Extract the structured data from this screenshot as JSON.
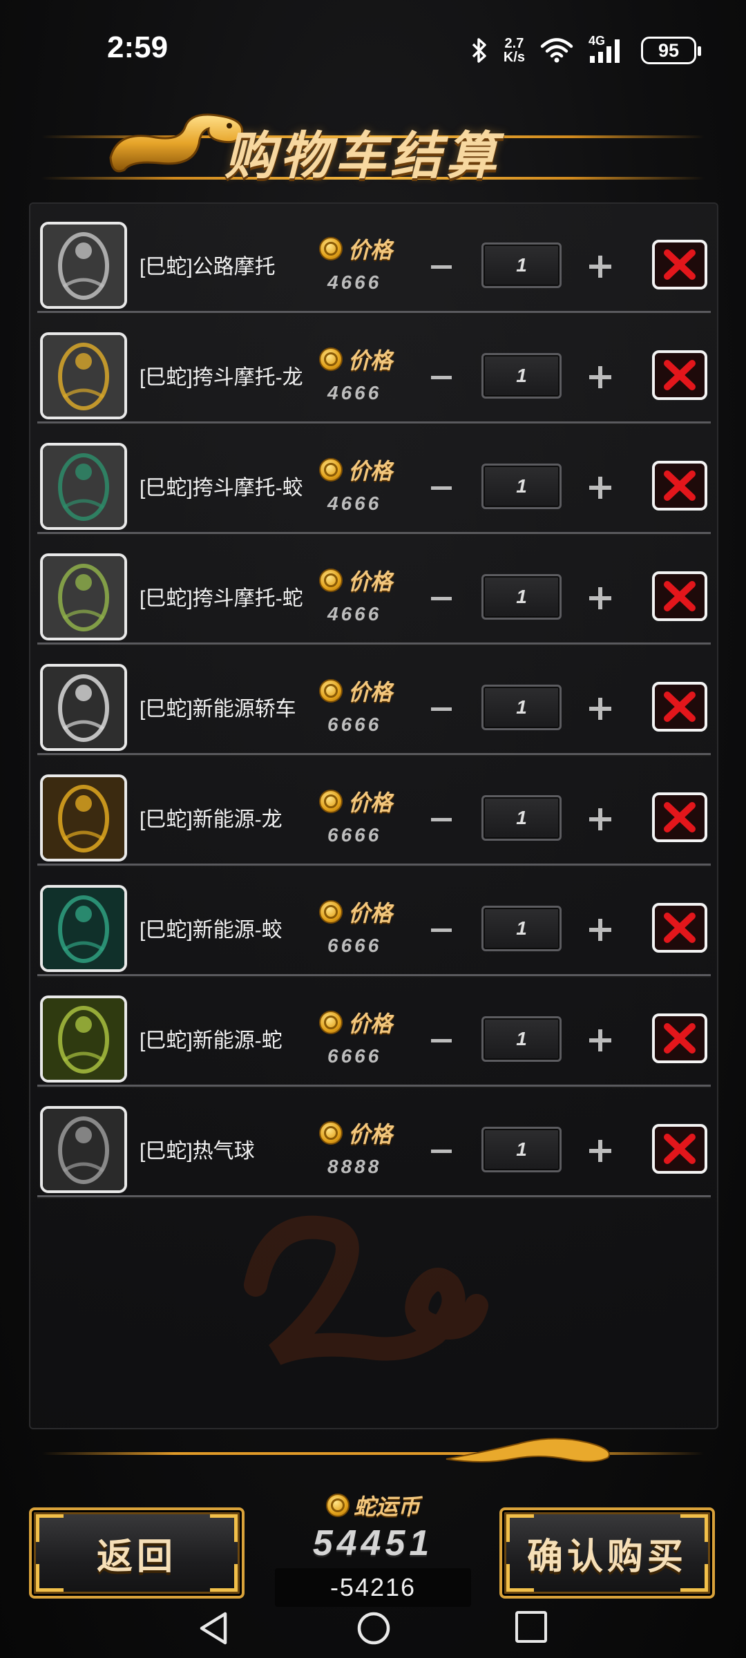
{
  "status_bar": {
    "time": "2:59",
    "net_speed_value": "2.7",
    "net_speed_unit": "K/s",
    "network_type": "4G",
    "battery": "95",
    "icons": [
      "bluetooth-icon",
      "wifi-icon",
      "signal-icon",
      "battery-icon"
    ]
  },
  "header": {
    "title": "购物车结算"
  },
  "cart": {
    "price_label": "价格",
    "items": [
      {
        "name": "[巳蛇]公路摩托",
        "price": "4666",
        "quantity": "1",
        "thumb_color": "#3a3a3a",
        "accent": "#bfbfbf"
      },
      {
        "name": "[巳蛇]挎斗摩托-龙",
        "price": "4666",
        "quantity": "1",
        "thumb_color": "#3a3a3a",
        "accent": "#d9a82a"
      },
      {
        "name": "[巳蛇]挎斗摩托-蛟",
        "price": "4666",
        "quantity": "1",
        "thumb_color": "#3a3a3a",
        "accent": "#2e8c6a"
      },
      {
        "name": "[巳蛇]挎斗摩托-蛇",
        "price": "4666",
        "quantity": "1",
        "thumb_color": "#3a3a3a",
        "accent": "#8fb04a"
      },
      {
        "name": "[巳蛇]新能源轿车",
        "price": "6666",
        "quantity": "1",
        "thumb_color": "#2e2e2e",
        "accent": "#d9d9d9"
      },
      {
        "name": "[巳蛇]新能源-龙",
        "price": "6666",
        "quantity": "1",
        "thumb_color": "#3b2a10",
        "accent": "#e0a820"
      },
      {
        "name": "[巳蛇]新能源-蛟",
        "price": "6666",
        "quantity": "1",
        "thumb_color": "#10302a",
        "accent": "#2fa080"
      },
      {
        "name": "[巳蛇]新能源-蛇",
        "price": "6666",
        "quantity": "1",
        "thumb_color": "#2f3a10",
        "accent": "#a8c040"
      },
      {
        "name": "[巳蛇]热气球",
        "price": "8888",
        "quantity": "1",
        "thumb_color": "#2a2a2a",
        "accent": "#9a9a9a"
      }
    ],
    "colors": {
      "remove_x": "#e3161b",
      "gold": "#f3c77d"
    }
  },
  "footer": {
    "back_label": "返回",
    "confirm_label": "确认购买",
    "balance_title": "蛇运币",
    "balance_value": "54451",
    "balance_delta": "-54216"
  },
  "nav_bar": {
    "icons": [
      "nav-back-icon",
      "nav-home-icon",
      "nav-recent-icon"
    ]
  }
}
